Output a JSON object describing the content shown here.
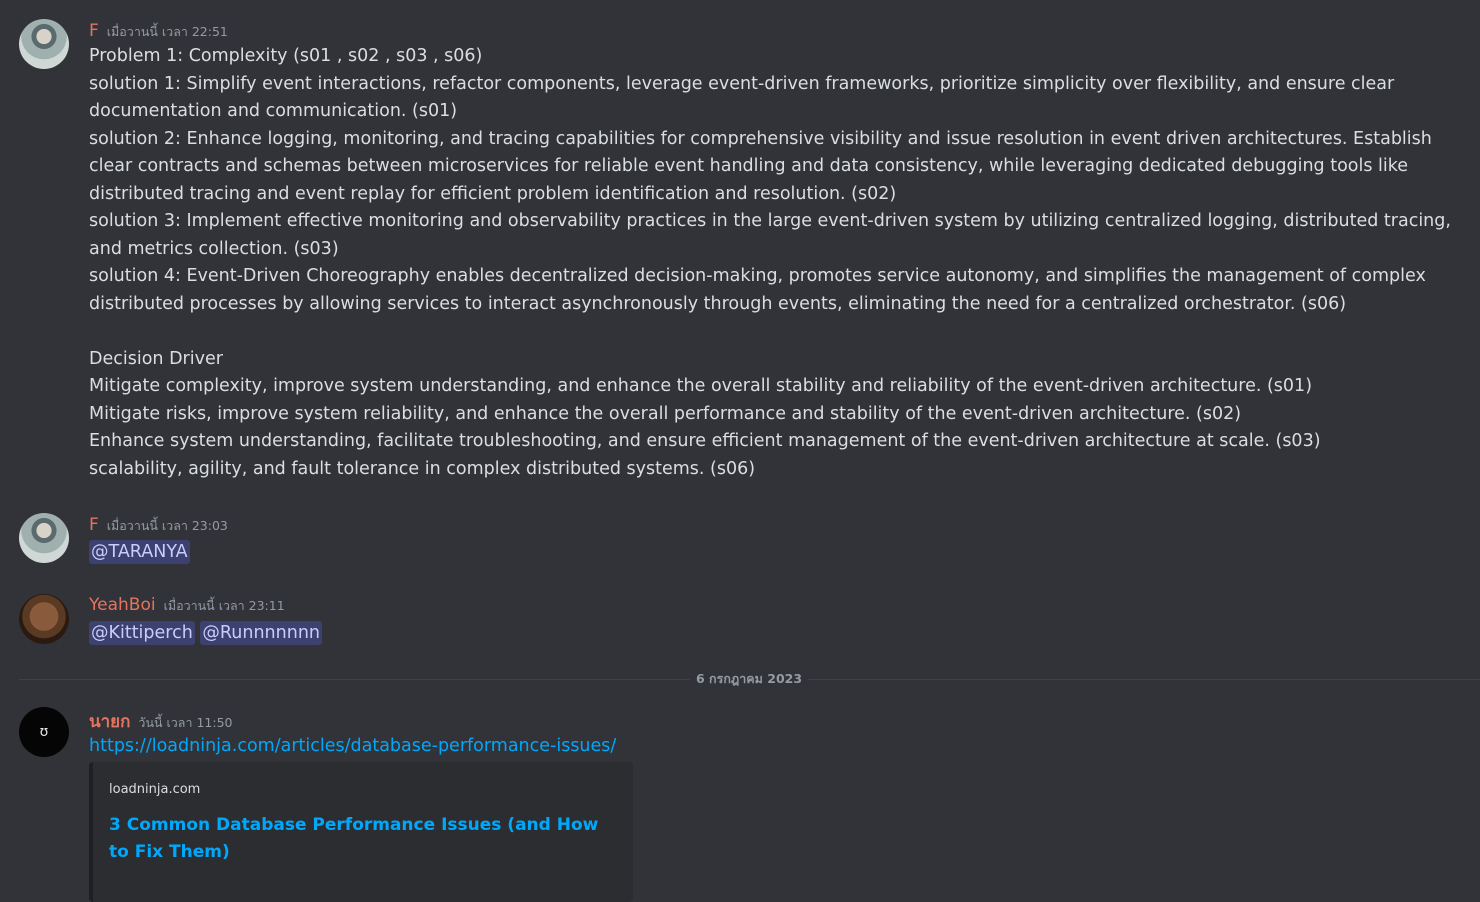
{
  "messages": [
    {
      "username": "F",
      "timestamp": "เมื่อวานนี้ เวลา 22:51",
      "lines": [
        "Problem 1: Complexity (s01 , s02 , s03 , s06)",
        "solution 1: Simplify event interactions, refactor components, leverage event-driven frameworks, prioritize simplicity over flexibility, and ensure clear documentation and communication. (s01)",
        "solution 2: Enhance logging, monitoring, and tracing capabilities for comprehensive visibility and issue resolution in event driven architectures. Establish clear contracts and schemas between microservices for reliable event handling and data consistency, while leveraging dedicated debugging tools like distributed tracing and event replay for efficient problem identification and resolution. (s02)",
        "solution 3: Implement effective monitoring and observability practices in the large event-driven system by utilizing centralized logging, distributed tracing, and metrics collection. (s03)",
        "solution 4: Event-Driven Choreography enables decentralized decision-making, promotes service autonomy, and simplifies the management of complex distributed processes by allowing services to interact asynchronously through events, eliminating the need for a centralized orchestrator. (s06)",
        "",
        "Decision Driver",
        "Mitigate complexity, improve system understanding, and enhance the overall stability and reliability of the event-driven architecture. (s01)",
        "Mitigate risks, improve system reliability, and enhance the overall performance and stability of the event-driven architecture. (s02)",
        "Enhance system understanding, facilitate troubleshooting, and ensure efficient management of the event-driven architecture at scale. (s03)",
        "scalability, agility, and fault tolerance in complex distributed systems. (s06)"
      ]
    },
    {
      "username": "F",
      "timestamp": "เมื่อวานนี้ เวลา 23:03",
      "mentions": [
        "@TARANYA"
      ]
    },
    {
      "username": "YeahBoi",
      "timestamp": "เมื่อวานนี้ เวลา 23:11",
      "mentions": [
        "@Kittiperch",
        "@Runnnnnnn"
      ]
    },
    {
      "username": "นายก",
      "timestamp": "วันนี้ เวลา 11:50",
      "link": "https://loadninja.com/articles/database-performance-issues/",
      "embed": {
        "provider": "loadninja.com",
        "title": "3 Common Database Performance Issues (and How to Fix Them)"
      }
    }
  ],
  "divider": {
    "date": "6 กรกฎาคม 2023"
  },
  "icons": {
    "avatar_nayok_glyph": "ʊ"
  }
}
